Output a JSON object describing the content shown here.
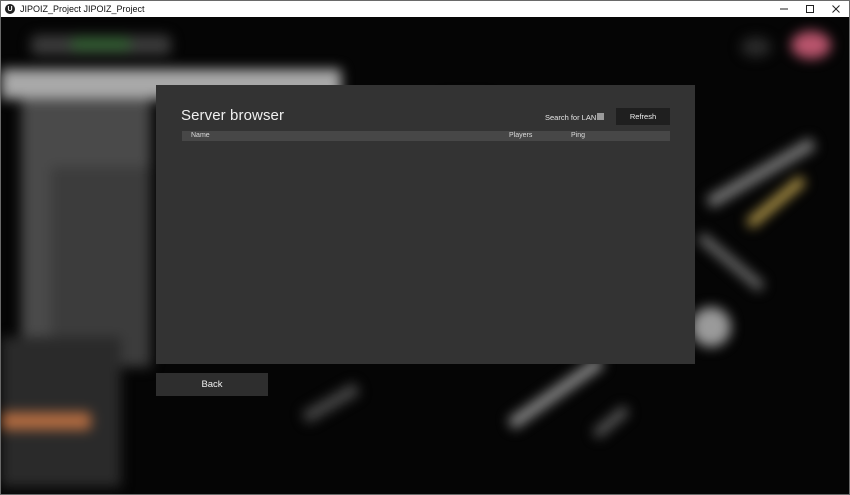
{
  "window": {
    "title": "JIPOIZ_Project JIPOIZ_Project",
    "app_icon_glyph": "U"
  },
  "server_browser": {
    "title": "Server browser",
    "lan_label": "Search for LAN",
    "lan_checked": false,
    "refresh_label": "Refresh",
    "columns": {
      "name": "Name",
      "players": "Players",
      "ping": "Ping"
    },
    "rows": []
  },
  "back_label": "Back",
  "colors": {
    "panel": "#333333",
    "header_row": "#474747",
    "refresh_button": "#1f1f1f",
    "back_button": "#2e2e2e",
    "checkbox": "#9a9a9a"
  }
}
